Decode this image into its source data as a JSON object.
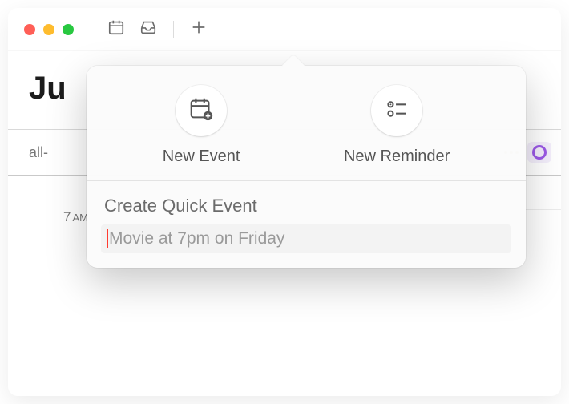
{
  "titlebar": {
    "icons": {
      "calendar": "calendar-icon",
      "inbox": "inbox-icon",
      "add": "plus-icon"
    }
  },
  "content": {
    "month_title_fragment": "Ju",
    "allday_label_fragment": "all-",
    "hours": [
      {
        "num": "7",
        "ampm": "AM"
      }
    ]
  },
  "popover": {
    "new_event_label": "New Event",
    "new_reminder_label": "New Reminder",
    "quick_title": "Create Quick Event",
    "quick_placeholder": "Movie at 7pm on Friday",
    "quick_value": ""
  }
}
